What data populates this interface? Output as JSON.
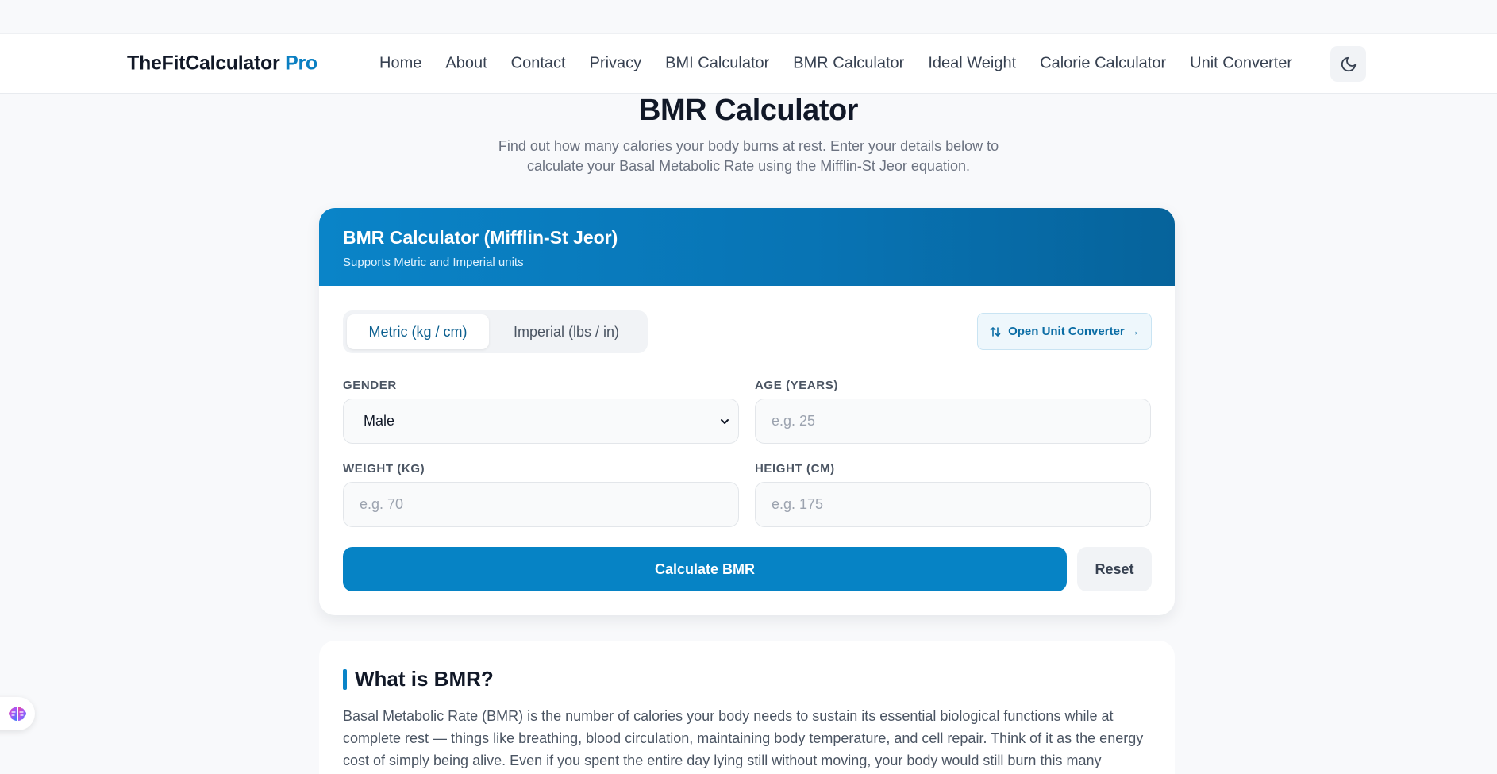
{
  "brand": {
    "name": "TheFitCalculator",
    "suffix": "Pro"
  },
  "nav": [
    "Home",
    "About",
    "Contact",
    "Privacy",
    "BMI Calculator",
    "BMR Calculator",
    "Ideal Weight",
    "Calorie Calculator",
    "Unit Converter"
  ],
  "hero": {
    "title": "BMR Calculator",
    "subtitle": "Find out how many calories your body burns at rest. Enter your details below to calculate your Basal Metabolic Rate using the Mifflin-St Jeor equation."
  },
  "calculator": {
    "title": "BMR Calculator (Mifflin-St Jeor)",
    "subtitle": "Supports Metric and Imperial units",
    "tabs": [
      "Metric (kg / cm)",
      "Imperial (lbs / in)"
    ],
    "converter_button": "Open Unit Converter →",
    "gender": {
      "label": "Gender",
      "value": "Male"
    },
    "age": {
      "label": "Age (years)",
      "placeholder": "e.g. 25"
    },
    "weight": {
      "label": "Weight (kg)",
      "placeholder": "e.g. 70"
    },
    "height": {
      "label": "Height (cm)",
      "placeholder": "e.g. 175"
    },
    "calculate_button": "Calculate BMR",
    "reset_button": "Reset"
  },
  "info": {
    "title": "What is BMR?",
    "text": "Basal Metabolic Rate (BMR) is the number of calories your body needs to sustain its essential biological functions while at complete rest — things like breathing, blood circulation, maintaining body temperature, and cell repair. Think of it as the energy cost of simply being alive. Even if you spent the entire day lying still without moving, your body would still burn this many calories."
  },
  "colors": {
    "accent": "#0683c5",
    "header_gradient_end": "#06639b"
  }
}
